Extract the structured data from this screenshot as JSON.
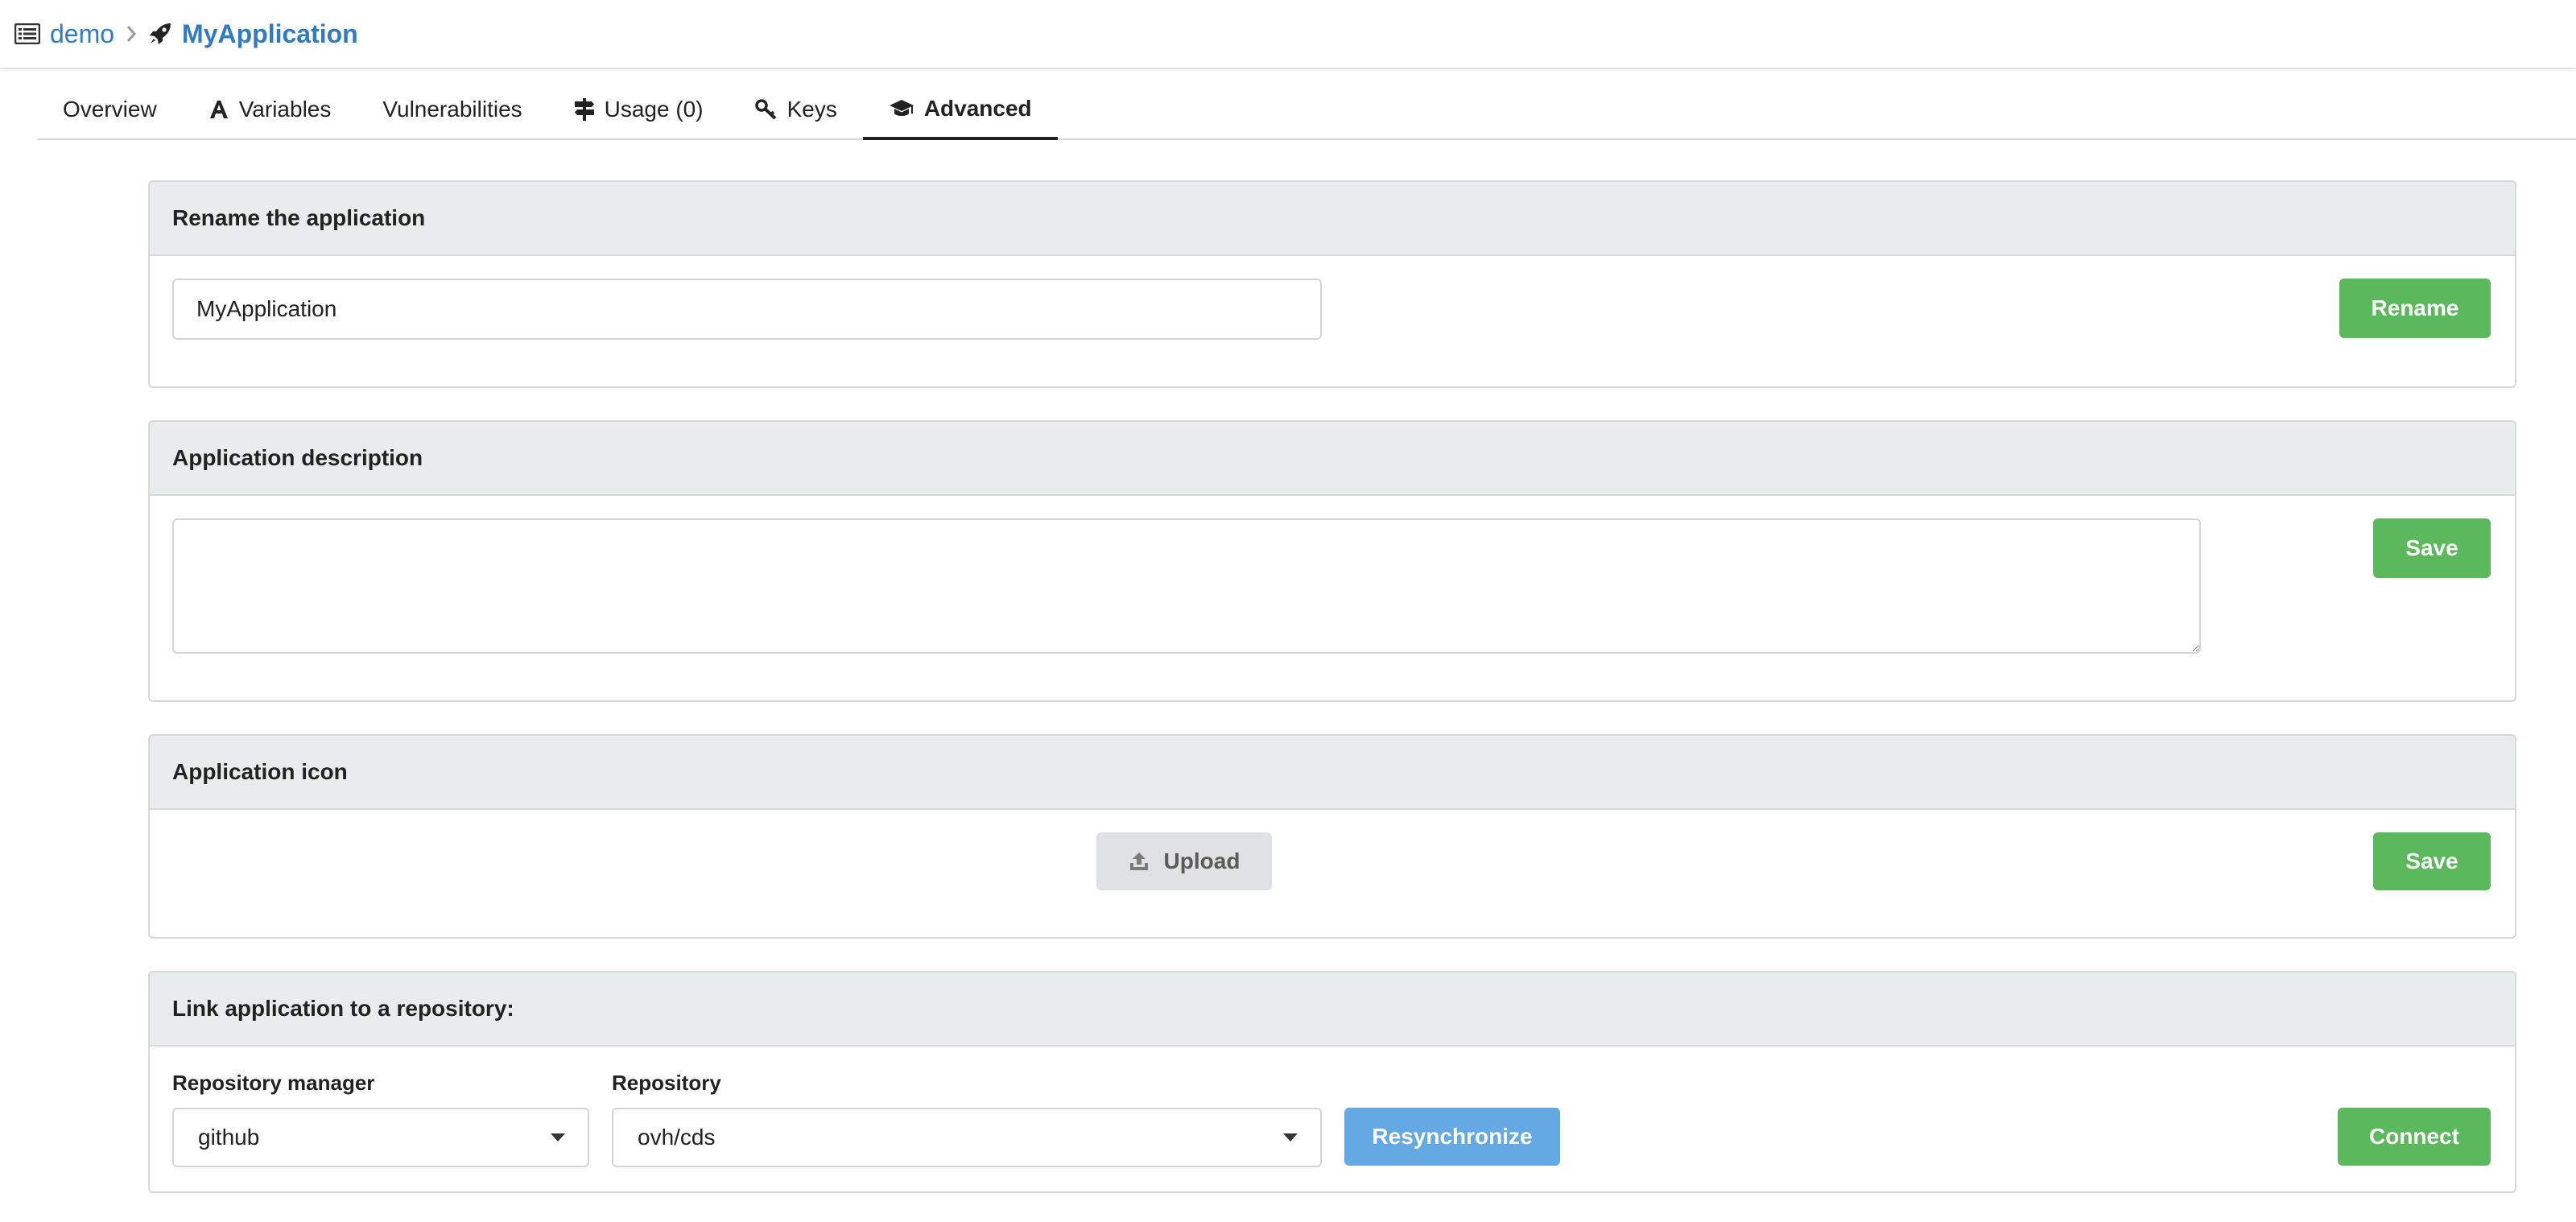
{
  "breadcrumb": {
    "project": "demo",
    "application": "MyApplication"
  },
  "tabs": [
    {
      "label": "Overview",
      "icon": ""
    },
    {
      "label": "Variables",
      "icon": "font-icon"
    },
    {
      "label": "Vulnerabilities",
      "icon": ""
    },
    {
      "label": "Usage (0)",
      "icon": "signpost-icon"
    },
    {
      "label": "Keys",
      "icon": "key-icon"
    },
    {
      "label": "Advanced",
      "icon": "graduation-cap-icon",
      "active": true
    }
  ],
  "rename": {
    "title": "Rename the application",
    "value": "MyApplication",
    "button": "Rename"
  },
  "description": {
    "title": "Application description",
    "value": "",
    "button": "Save"
  },
  "icon_section": {
    "title": "Application icon",
    "upload": "Upload",
    "button": "Save"
  },
  "repository": {
    "title": "Link application to a repository:",
    "manager_label": "Repository manager",
    "manager_value": "github",
    "repo_label": "Repository",
    "repo_value": "ovh/cds",
    "resync": "Resynchronize",
    "connect": "Connect"
  },
  "colors": {
    "link": "#2e7bc4",
    "green": "#5cb85c",
    "blue": "#64a8e4",
    "header_bg": "#e9ecec"
  }
}
